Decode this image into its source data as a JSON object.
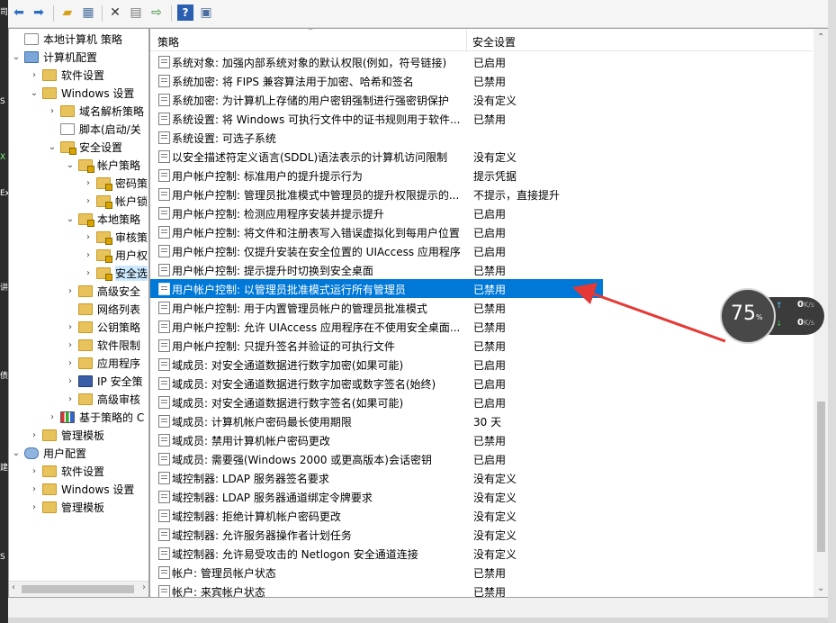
{
  "toolbar": {
    "icons": [
      "back-arrow-icon",
      "forward-arrow-icon",
      "up-folder-icon",
      "show-tree-icon",
      "delete-icon",
      "properties-icon",
      "export-icon",
      "help-icon",
      "view-icon"
    ]
  },
  "tree": {
    "items": [
      {
        "label": "本地计算机 策略"
      },
      {
        "label": "计算机配置"
      },
      {
        "label": "软件设置"
      },
      {
        "label": "Windows 设置"
      },
      {
        "label": "域名解析策略"
      },
      {
        "label": "脚本(启动/关"
      },
      {
        "label": "安全设置"
      },
      {
        "label": "帐户策略"
      },
      {
        "label": "密码策"
      },
      {
        "label": "帐户锁"
      },
      {
        "label": "本地策略"
      },
      {
        "label": "审核策"
      },
      {
        "label": "用户权"
      },
      {
        "label": "安全选"
      },
      {
        "label": "高级安全"
      },
      {
        "label": "网络列表"
      },
      {
        "label": "公钥策略"
      },
      {
        "label": "软件限制"
      },
      {
        "label": "应用程序"
      },
      {
        "label": "IP 安全策"
      },
      {
        "label": "高级审核"
      },
      {
        "label": "基于策略的 C"
      },
      {
        "label": "管理模板"
      },
      {
        "label": "用户配置"
      },
      {
        "label": "软件设置"
      },
      {
        "label": "Windows 设置"
      },
      {
        "label": "管理模板"
      }
    ]
  },
  "list": {
    "header": {
      "policy": "策略",
      "setting": "安全设置"
    },
    "rows": [
      {
        "policy": "系统对象: 加强内部系统对象的默认权限(例如，符号链接)",
        "setting": "已启用"
      },
      {
        "policy": "系统加密: 将 FIPS 兼容算法用于加密、哈希和签名",
        "setting": "已禁用"
      },
      {
        "policy": "系统加密: 为计算机上存储的用户密钥强制进行强密钥保护",
        "setting": "没有定义"
      },
      {
        "policy": "系统设置: 将 Windows 可执行文件中的证书规则用于软件...",
        "setting": "已禁用"
      },
      {
        "policy": "系统设置: 可选子系统",
        "setting": ""
      },
      {
        "policy": "以安全描述符定义语言(SDDL)语法表示的计算机访问限制",
        "setting": "没有定义"
      },
      {
        "policy": "用户帐户控制: 标准用户的提升提示行为",
        "setting": "提示凭据"
      },
      {
        "policy": "用户帐户控制: 管理员批准模式中管理员的提升权限提示的...",
        "setting": "不提示，直接提升"
      },
      {
        "policy": "用户帐户控制: 检测应用程序安装并提示提升",
        "setting": "已启用"
      },
      {
        "policy": "用户帐户控制: 将文件和注册表写入错误虚拟化到每用户位置",
        "setting": "已启用"
      },
      {
        "policy": "用户帐户控制: 仅提升安装在安全位置的 UIAccess 应用程序",
        "setting": "已启用"
      },
      {
        "policy": "用户帐户控制: 提示提升时切换到安全桌面",
        "setting": "已禁用"
      },
      {
        "policy": "用户帐户控制: 以管理员批准模式运行所有管理员",
        "setting": "已禁用"
      },
      {
        "policy": "用户帐户控制: 用于内置管理员帐户的管理员批准模式",
        "setting": "已禁用"
      },
      {
        "policy": "用户帐户控制: 允许 UIAccess 应用程序在不使用安全桌面...",
        "setting": "已禁用"
      },
      {
        "policy": "用户帐户控制: 只提升签名并验证的可执行文件",
        "setting": "已禁用"
      },
      {
        "policy": "域成员: 对安全通道数据进行数字加密(如果可能)",
        "setting": "已启用"
      },
      {
        "policy": "域成员: 对安全通道数据进行数字加密或数字签名(始终)",
        "setting": "已启用"
      },
      {
        "policy": "域成员: 对安全通道数据进行数字签名(如果可能)",
        "setting": "已启用"
      },
      {
        "policy": "域成员: 计算机帐户密码最长使用期限",
        "setting": "30 天"
      },
      {
        "policy": "域成员: 禁用计算机帐户密码更改",
        "setting": "已禁用"
      },
      {
        "policy": "域成员: 需要强(Windows 2000 或更高版本)会话密钥",
        "setting": "已启用"
      },
      {
        "policy": "域控制器: LDAP 服务器签名要求",
        "setting": "没有定义"
      },
      {
        "policy": "域控制器: LDAP 服务器通道绑定令牌要求",
        "setting": "没有定义"
      },
      {
        "policy": "域控制器: 拒绝计算机帐户密码更改",
        "setting": "没有定义"
      },
      {
        "policy": "域控制器: 允许服务器操作者计划任务",
        "setting": "没有定义"
      },
      {
        "policy": "域控制器:  允许易受攻击的 Netlogon 安全通道连接",
        "setting": "没有定义"
      },
      {
        "policy": "帐户: 管理员帐户状态",
        "setting": "已禁用"
      },
      {
        "policy": "帐户: 来宾帐户状态",
        "setting": "已禁用"
      }
    ]
  },
  "widget": {
    "percent": "75",
    "percent_unit": "%",
    "upload": "0",
    "download": "0",
    "unit": "K/s"
  },
  "left_edge_text": [
    "司",
    "S",
    "X",
    "Ex",
    "讲",
    "债",
    "建",
    "S"
  ],
  "colors": {
    "selection": "#0078d7",
    "arrow": "#e53935"
  }
}
